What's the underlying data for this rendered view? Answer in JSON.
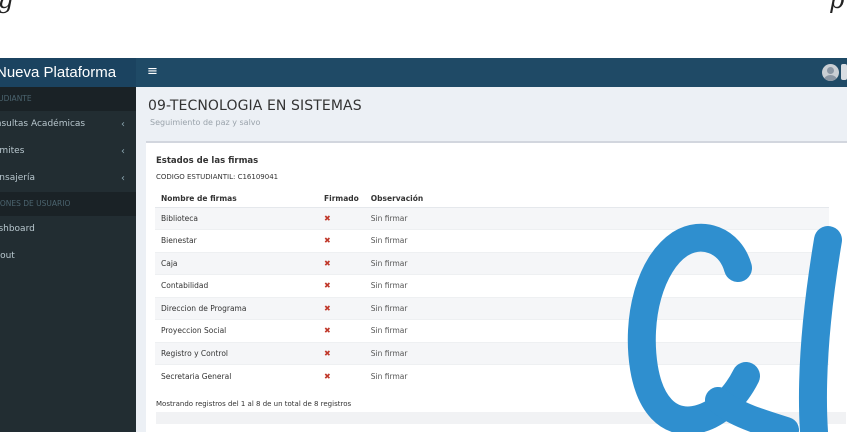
{
  "caption": {
    "left_text": "g",
    "right_text": "p"
  },
  "topbar": {
    "brand": "Nueva Plataforma",
    "menu_toggle": "≡",
    "user_icon": "user-avatar-icon"
  },
  "sidebar": {
    "section_student": "ESTUDIANTE",
    "items_student": [
      {
        "label": "Consultas Académicas",
        "icon": "chevron-left-icon"
      },
      {
        "label": "Trámites",
        "icon": "chevron-left-icon"
      },
      {
        "label": "Mensajería",
        "icon": "chevron-left-icon"
      }
    ],
    "section_user": "OPCIONES DE USUARIO",
    "items_user": [
      {
        "label": "Dashboard"
      },
      {
        "label": "Logout"
      }
    ]
  },
  "main": {
    "title": "09-TECNOLOGIA EN SISTEMAS",
    "subtitle": "Seguimiento de paz y salvo",
    "box": {
      "title": "Estados de las firmas",
      "code": "CODIGO ESTUDIANTIL: C16109041",
      "columns": [
        "Nombre de firmas",
        "Firmado",
        "Observación"
      ],
      "rows": [
        {
          "name": "Biblioteca",
          "signed": "✖",
          "observation": "Sin firmar"
        },
        {
          "name": "Bienestar",
          "signed": "✖",
          "observation": "Sin firmar"
        },
        {
          "name": "Caja",
          "signed": "✖",
          "observation": "Sin firmar"
        },
        {
          "name": "Contabilidad",
          "signed": "✖",
          "observation": "Sin firmar"
        },
        {
          "name": "Direccion de Programa",
          "signed": "✖",
          "observation": "Sin firmar"
        },
        {
          "name": "Proyeccion Social",
          "signed": "✖",
          "observation": "Sin firmar"
        },
        {
          "name": "Registro y Control",
          "signed": "✖",
          "observation": "Sin firmar"
        },
        {
          "name": "Secretaria General",
          "signed": "✖",
          "observation": "Sin firmar"
        }
      ],
      "footer": "Mostrando registros del 1 al 8 de un total de 8 registros"
    }
  },
  "colors": {
    "topbar": "#1f4a66",
    "sidebar": "#222d32",
    "content_bg": "#ecf0f5",
    "x_mark": "#c0392b",
    "doodle": "#2f8fcf"
  }
}
